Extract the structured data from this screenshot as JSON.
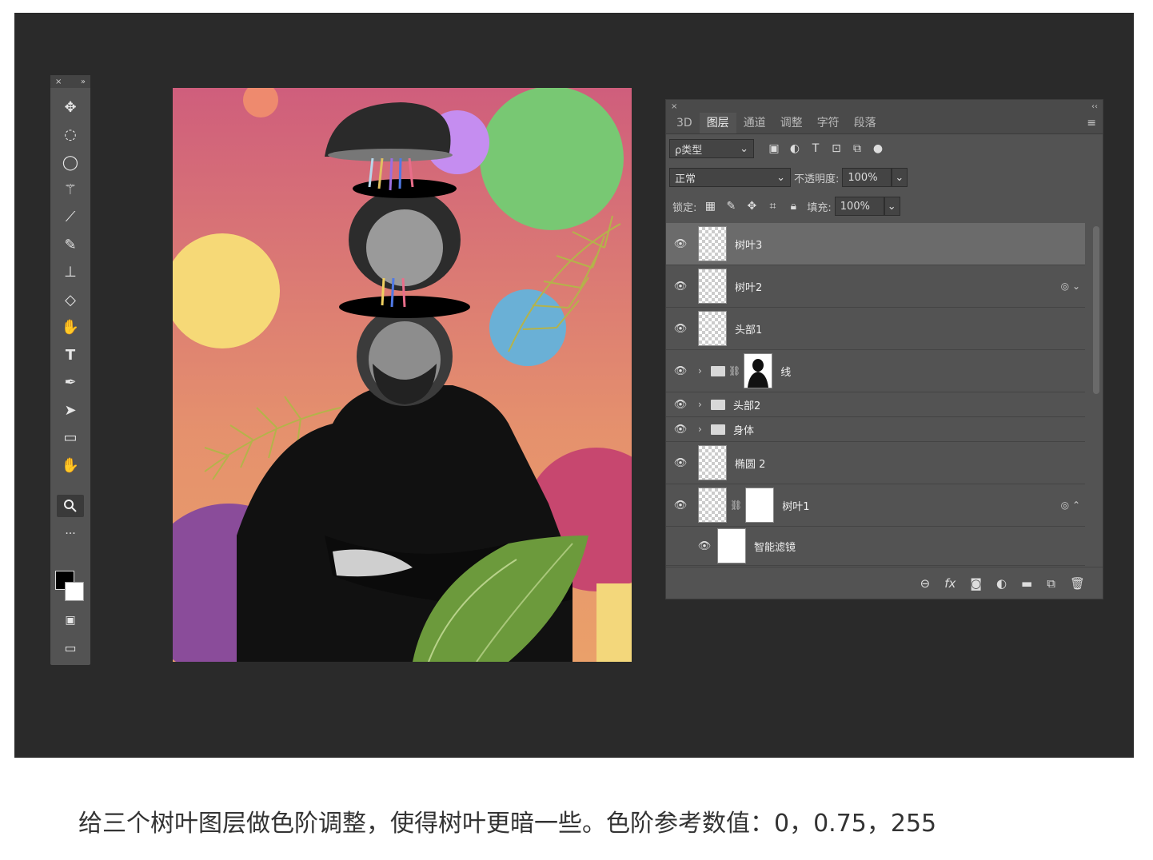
{
  "toolbar": {
    "close": "×",
    "collapse": "»",
    "tools": [
      {
        "name": "move-tool-icon",
        "glyph": "✥"
      },
      {
        "name": "marquee-tool-icon",
        "glyph": "◌"
      },
      {
        "name": "lasso-tool-icon",
        "glyph": "◯"
      },
      {
        "name": "magic-wand-tool-icon",
        "glyph": "⚚"
      },
      {
        "name": "eyedropper-tool-icon",
        "glyph": "⟋"
      },
      {
        "name": "brush-tool-icon",
        "glyph": "✎"
      },
      {
        "name": "stamp-tool-icon",
        "glyph": "⊥"
      },
      {
        "name": "eraser-tool-icon",
        "glyph": "◇"
      },
      {
        "name": "burn-tool-icon",
        "glyph": "✋"
      },
      {
        "name": "type-tool-icon",
        "glyph": "T"
      },
      {
        "name": "pen-tool-icon",
        "glyph": "✒"
      },
      {
        "name": "path-select-tool-icon",
        "glyph": "➤"
      },
      {
        "name": "rectangle-tool-icon",
        "glyph": "▭"
      },
      {
        "name": "rotate-view-tool-icon",
        "glyph": "✋"
      },
      {
        "name": "zoom-tool-icon",
        "glyph": "🔍︎"
      },
      {
        "name": "more-tools-icon",
        "glyph": "···"
      }
    ]
  },
  "panel": {
    "close": "×",
    "collapse": "‹‹",
    "tabs": [
      "3D",
      "图层",
      "通道",
      "调整",
      "字符",
      "段落"
    ],
    "active_tab": "图层",
    "filter_label": "ρ类型",
    "blend_mode": "正常",
    "opacity_label": "不透明度:",
    "opacity_value": "100%",
    "lock_label": "锁定:",
    "fill_label": "填充:",
    "fill_value": "100%",
    "layers": [
      {
        "name": "树叶3"
      },
      {
        "name": "树叶2"
      },
      {
        "name": "头部1"
      },
      {
        "name": "线"
      },
      {
        "name": "头部2"
      },
      {
        "name": "身体"
      },
      {
        "name": "椭圆 2"
      },
      {
        "name": "树叶1"
      },
      {
        "name": "智能滤镜"
      }
    ]
  },
  "caption": "给三个树叶图层做色阶调整，使得树叶更暗一些。色阶参考数值：0，0.75，255"
}
